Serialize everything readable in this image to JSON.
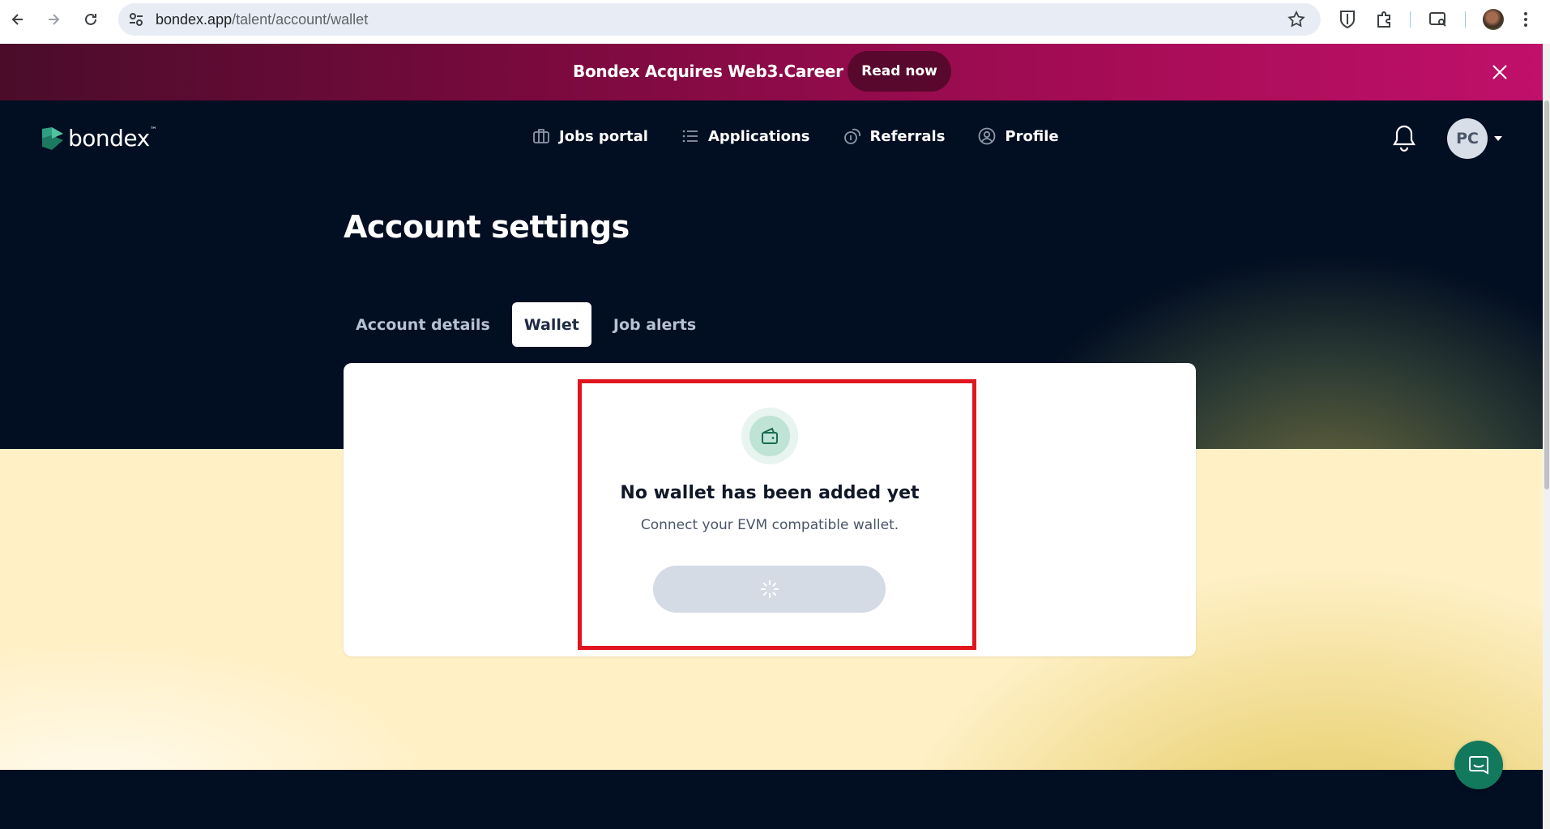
{
  "browser": {
    "url_host": "bondex.app",
    "url_path": "/talent/account/wallet"
  },
  "promo": {
    "title": "Bondex Acquires Web3.Career",
    "button": "Read now"
  },
  "header": {
    "logo_text": "bondex",
    "logo_tm": "™",
    "nav": [
      {
        "label": "Jobs portal",
        "icon": "briefcase-icon"
      },
      {
        "label": "Applications",
        "icon": "list-icon"
      },
      {
        "label": "Referrals",
        "icon": "referral-coins-icon"
      },
      {
        "label": "Profile",
        "icon": "user-circle-icon"
      }
    ],
    "avatar_initials": "PC"
  },
  "page": {
    "title": "Account settings",
    "tabs": [
      {
        "label": "Account details",
        "active": false
      },
      {
        "label": "Wallet",
        "active": true
      },
      {
        "label": "Job alerts",
        "active": false
      }
    ]
  },
  "wallet": {
    "empty_title": "No wallet has been added yet",
    "empty_subtitle": "Connect your EVM compatible wallet.",
    "button_state": "loading"
  },
  "colors": {
    "brand_dark": "#020e22",
    "promo_accent": "#c0106a",
    "highlight": "#e0161e",
    "chat_green": "#12795d"
  }
}
